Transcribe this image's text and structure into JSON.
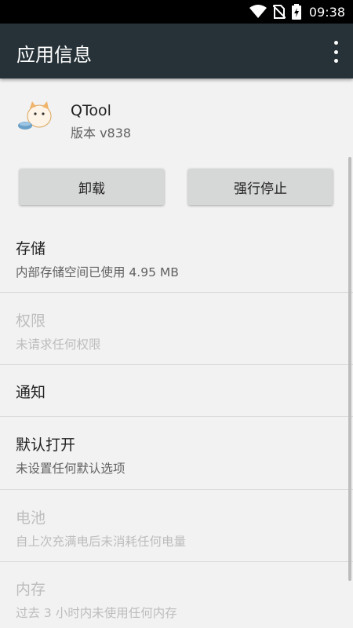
{
  "status_bar": {
    "time": "09:38",
    "icons": [
      "wifi-icon",
      "no-sim-icon",
      "battery-charging-icon"
    ]
  },
  "app_bar": {
    "title": "应用信息",
    "menu_icon": "more-vert-icon"
  },
  "app": {
    "name": "QTool",
    "version": "版本 v838",
    "icon": "cat-app-icon"
  },
  "buttons": {
    "uninstall": "卸载",
    "force_stop": "强行停止"
  },
  "settings": [
    {
      "title": "存储",
      "subtitle": "内部存储空间已使用 4.95 MB",
      "enabled": true
    },
    {
      "title": "权限",
      "subtitle": "未请求任何权限",
      "enabled": false
    },
    {
      "title": "通知",
      "subtitle": "",
      "enabled": true
    },
    {
      "title": "默认打开",
      "subtitle": "未设置任何默认选项",
      "enabled": true
    },
    {
      "title": "电池",
      "subtitle": "自上次充满电后未消耗任何电量",
      "enabled": false
    },
    {
      "title": "内存",
      "subtitle": "过去 3 小时内未使用任何内存",
      "enabled": false
    }
  ],
  "colors": {
    "app_bar": "#263238",
    "background": "#f2f2f2",
    "button": "#d6d7d7",
    "disabled_text": "#bdbdbd"
  }
}
